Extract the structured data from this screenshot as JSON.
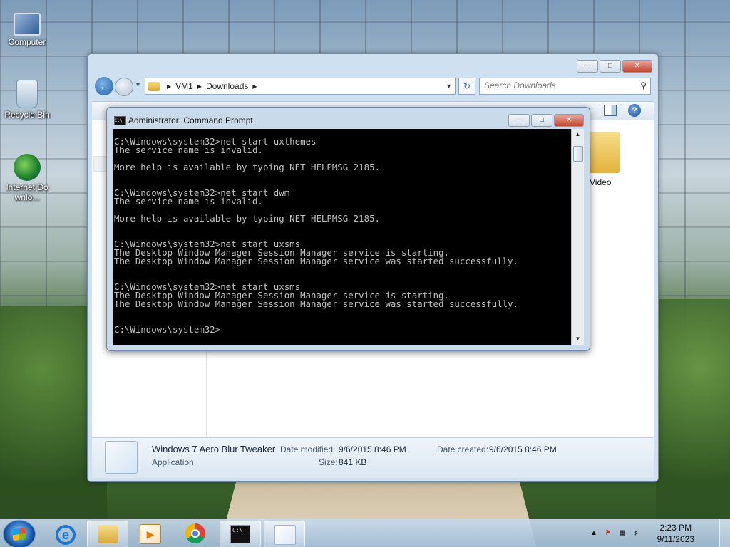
{
  "desktop": {
    "icons": [
      {
        "label": "Computer"
      },
      {
        "label": "Recycle Bin"
      },
      {
        "label": "Internet Downlo..."
      }
    ]
  },
  "explorer": {
    "breadcrumb": [
      "VM1",
      "Downloads"
    ],
    "search_placeholder": "Search Downloads",
    "folder_label": "Video",
    "details": {
      "name": "Windows 7 Aero Blur Tweaker",
      "type": "Application",
      "date_modified_label": "Date modified:",
      "date_modified": "9/6/2015 8:46 PM",
      "date_created_label": "Date created:",
      "date_created": "9/6/2015 8:46 PM",
      "size_label": "Size:",
      "size": "841 KB"
    }
  },
  "cmd": {
    "title": "Administrator: Command Prompt",
    "lines": [
      "",
      "C:\\Windows\\system32>net start uxthemes",
      "The service name is invalid.",
      "",
      "More help is available by typing NET HELPMSG 2185.",
      "",
      "",
      "C:\\Windows\\system32>net start dwm",
      "The service name is invalid.",
      "",
      "More help is available by typing NET HELPMSG 2185.",
      "",
      "",
      "C:\\Windows\\system32>net start uxsms",
      "The Desktop Window Manager Session Manager service is starting.",
      "The Desktop Window Manager Session Manager service was started successfully.",
      "",
      "",
      "C:\\Windows\\system32>net start uxsms",
      "The Desktop Window Manager Session Manager service is starting.",
      "The Desktop Window Manager Session Manager service was started successfully.",
      "",
      "",
      "C:\\Windows\\system32>"
    ]
  },
  "taskbar": {
    "time": "2:23 PM",
    "date": "9/11/2023"
  },
  "icons": {
    "start": "windows-logo-icon",
    "ie": "internet-explorer-icon",
    "explorer": "folder-icon",
    "media": "media-player-icon",
    "chrome": "chrome-icon",
    "cmd": "command-prompt-icon"
  }
}
